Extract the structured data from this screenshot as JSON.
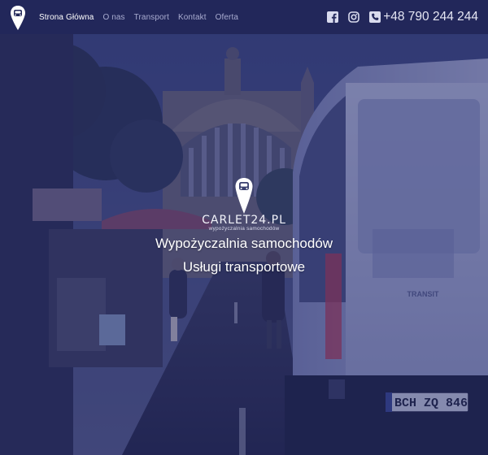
{
  "nav": {
    "items": [
      {
        "label": "Strona Główna",
        "active": true
      },
      {
        "label": "O nas",
        "active": false
      },
      {
        "label": "Transport",
        "active": false
      },
      {
        "label": "Kontakt",
        "active": false
      },
      {
        "label": "Oferta",
        "active": false
      }
    ]
  },
  "contacts": {
    "facebook_icon": "facebook-icon",
    "instagram_icon": "instagram-icon",
    "phone_icon": "phone-icon",
    "phone": "+48 790 244 244"
  },
  "hero": {
    "brand_name": "CARLET24.PL",
    "brand_subtitle": "wypożyczalnia samochodów",
    "line1": "Wypożyczalnia samochodów",
    "line2": "Usługi transportowe",
    "van_badge": "TRANSIT",
    "plate": "BCH ZQ 846"
  },
  "colors": {
    "header_bg": "#22275a",
    "overlay": "#22265f",
    "text_active": "#ffffff",
    "text_muted": "#a9acd0"
  }
}
